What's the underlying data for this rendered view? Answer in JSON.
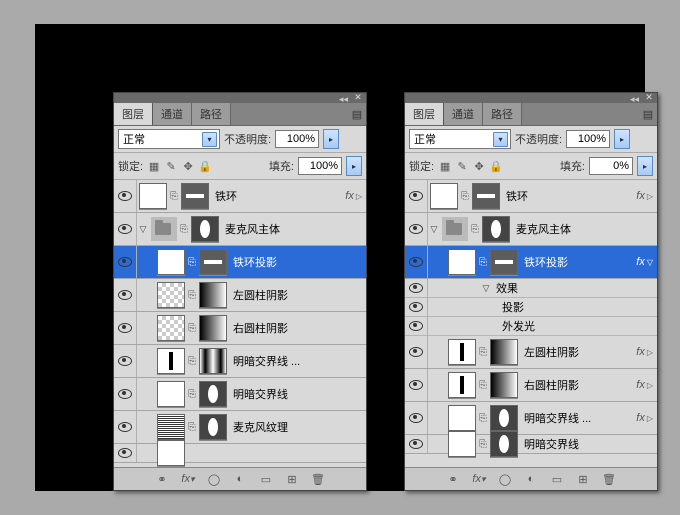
{
  "tabs": {
    "layers": "图层",
    "channels": "通道",
    "paths": "路径"
  },
  "blend_mode": "正常",
  "opacity_label": "不透明度:",
  "opacity_val": "100%",
  "lock_label": "锁定:",
  "fill_label": "填充:",
  "fx_label": "fx",
  "effects_label": "效果",
  "effect_drop": "投影",
  "effect_outer": "外发光",
  "left_panel": {
    "fill_val": "100%",
    "layers": [
      {
        "name": "铁环",
        "indent": 0,
        "thumbs": [
          "white",
          "mask-rect"
        ],
        "fx": true
      },
      {
        "name": "麦克风主体",
        "indent": 0,
        "folder": true,
        "disclose": "▽",
        "mask": true
      },
      {
        "name": "铁环投影",
        "indent": 1,
        "thumbs": [
          "white",
          "mask-rect"
        ],
        "sel": true
      },
      {
        "name": "左圆柱阴影",
        "indent": 1,
        "thumbs": [
          "checker",
          "grad"
        ]
      },
      {
        "name": "右圆柱阴影",
        "indent": 1,
        "thumbs": [
          "checker",
          "grad"
        ]
      },
      {
        "name": "明暗交界线 ...",
        "indent": 1,
        "thumbs": [
          "bar",
          "grad-c"
        ]
      },
      {
        "name": "明暗交界线",
        "indent": 1,
        "thumbs": [
          "white",
          "mask-ellipse"
        ]
      },
      {
        "name": "麦克风纹理",
        "indent": 1,
        "thumbs": [
          "tex",
          "mask-ellipse"
        ]
      },
      {
        "name": "",
        "indent": 1,
        "thumbs": [
          "white"
        ],
        "partial": true
      }
    ]
  },
  "right_panel": {
    "fill_val": "0%",
    "layers": [
      {
        "name": "铁环",
        "indent": 0,
        "thumbs": [
          "white",
          "mask-rect"
        ],
        "fx": true
      },
      {
        "name": "麦克风主体",
        "indent": 0,
        "folder": true,
        "disclose": "▽",
        "mask": true
      },
      {
        "name": "铁环投影",
        "indent": 1,
        "thumbs": [
          "white",
          "mask-rect"
        ],
        "sel": true,
        "fx": true,
        "fxopen": true
      },
      {
        "effect_header": true
      },
      {
        "effect": "drop"
      },
      {
        "effect": "outer"
      },
      {
        "name": "左圆柱阴影",
        "indent": 1,
        "thumbs": [
          "bar",
          "grad"
        ],
        "fx": true
      },
      {
        "name": "右圆柱阴影",
        "indent": 1,
        "thumbs": [
          "bar",
          "grad"
        ],
        "fx": true
      },
      {
        "name": "明暗交界线 ...",
        "indent": 1,
        "thumbs": [
          "white",
          "mask-ellipse"
        ],
        "fx": true
      },
      {
        "name": "明暗交界线",
        "indent": 1,
        "thumbs": [
          "white",
          "mask-ellipse"
        ],
        "partial": true
      }
    ]
  }
}
